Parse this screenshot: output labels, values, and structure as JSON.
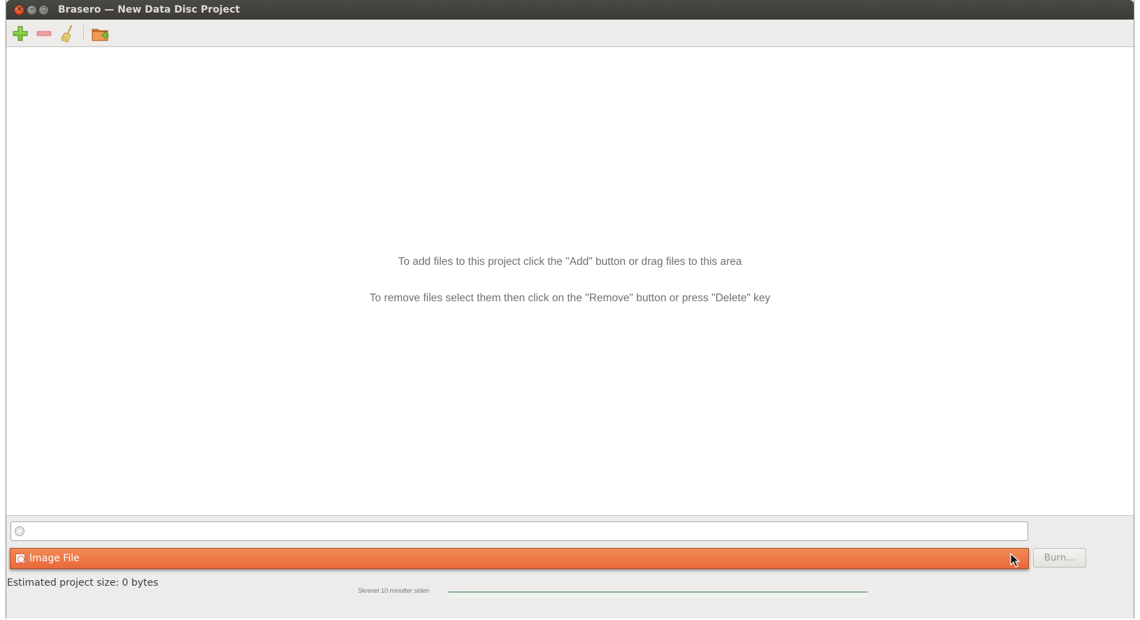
{
  "window": {
    "title": "Brasero — New Data Disc Project",
    "controls": {
      "close": "×",
      "minimize": "–",
      "maximize": "▫"
    }
  },
  "toolbar": {
    "buttons": [
      {
        "name": "add-icon"
      },
      {
        "name": "remove-icon"
      },
      {
        "name": "clear-broom-icon"
      },
      {
        "name": "new-folder-icon"
      }
    ]
  },
  "content": {
    "hint_add": "To add files to this project click the \"Add\" button or drag files to this area",
    "hint_remove": "To remove files select them then click on the \"Remove\" button or press \"Delete\" key"
  },
  "disc_name": {
    "value": ""
  },
  "target": {
    "selected": "Image File"
  },
  "burn_button": {
    "label": "Burn..."
  },
  "status": {
    "project_size": "Estimated project size: 0 bytes"
  },
  "background_window": {
    "text": "Skrevet 10 minutter siden"
  }
}
